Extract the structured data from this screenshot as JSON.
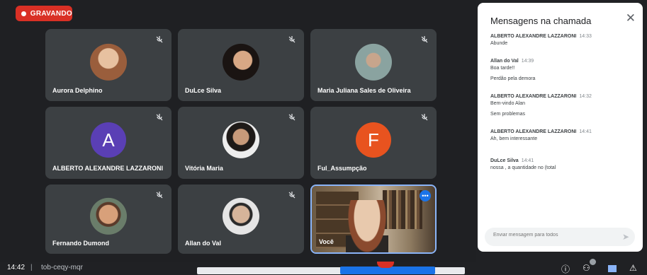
{
  "recording": {
    "label": "GRAVANDO"
  },
  "participants": [
    {
      "name": "Aurora Delphino",
      "type": "photo",
      "color": "#b07a55"
    },
    {
      "name": "DuLce Silva",
      "type": "photo",
      "color": "#6b4a3a"
    },
    {
      "name": "Maria Juliana Sales de Oliveira",
      "type": "photo",
      "color": "#8aa3a0"
    },
    {
      "name": "ALBERTO ALEXANDRE LAZZARONI",
      "type": "letter",
      "letter": "A",
      "color": "#5a3fb5"
    },
    {
      "name": "Vitória Maria",
      "type": "photo",
      "color": "#7a5f50"
    },
    {
      "name": "Ful_Assumpção",
      "type": "letter",
      "letter": "F",
      "color": "#e8531f"
    },
    {
      "name": "Fernando Dumond",
      "type": "photo",
      "color": "#a67656"
    },
    {
      "name": "Allan do Val",
      "type": "photo",
      "color": "#8f8f8f"
    },
    {
      "name": "Você",
      "type": "video",
      "color": "#8b7356"
    }
  ],
  "chat": {
    "title": "Mensagens na chamada",
    "messages": [
      {
        "sender": "ALBERTO ALEXANDRE LAZZARONI",
        "time": "14:33",
        "lines": [
          "Abunde"
        ]
      },
      {
        "sender": "Allan do Val",
        "time": "14:39",
        "lines": [
          "Boa tarde!!",
          "Perdão pela demora"
        ]
      },
      {
        "sender": "ALBERTO ALEXANDRE LAZZARONI",
        "time": "14:32",
        "lines": [
          "Bem-vindo Alan",
          "Sem problemas"
        ]
      },
      {
        "sender": "ALBERTO ALEXANDRE LAZZARONI",
        "time": "14:41",
        "lines": [
          "Ah, bem interessante"
        ]
      },
      {
        "sender": "DuLce Silva",
        "time": "14:41",
        "lines": [
          "nossa , a quantidade no (total"
        ]
      }
    ],
    "input_placeholder": "Enviar mensagem para todos"
  },
  "bottombar": {
    "clock": "14:42",
    "separator": "|",
    "meeting_code": "tob-ceqy-mqr"
  }
}
